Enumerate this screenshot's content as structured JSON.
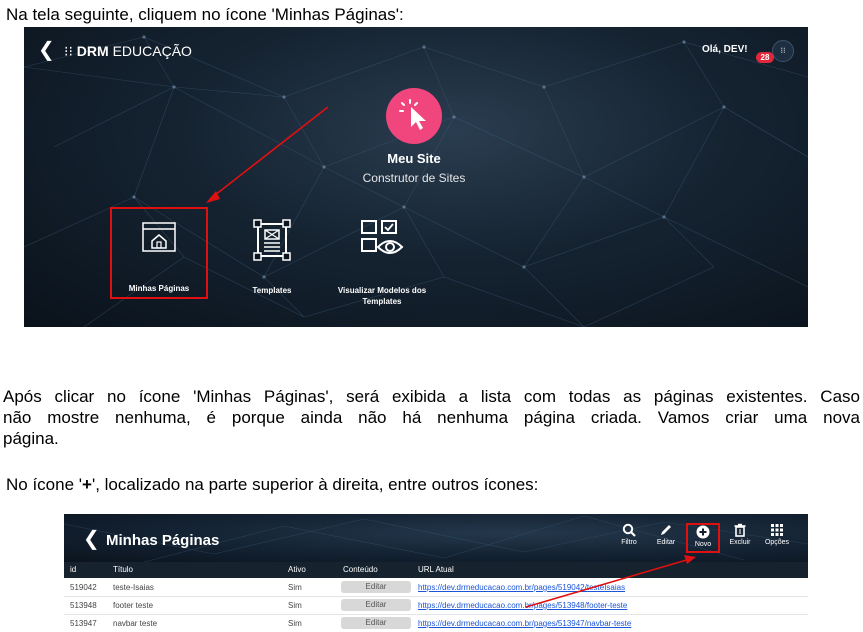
{
  "text": {
    "intro": "Na tela seguinte, cliquem no ícone 'Minhas Páginas':",
    "para2_lines": [
      "Após clicar no ícone 'Minhas Páginas', será exibida a lista com todas as páginas existentes. Caso",
      "não mostre nenhuma, é porque ainda não há nenhuma página criada. Vamos criar uma nova",
      "página."
    ],
    "para3_prefix": "No ícone '",
    "para3_plus": "+",
    "para3_suffix": "', localizado na parte superior à direita, entre outros ícones:"
  },
  "screenshot1": {
    "back": "❮",
    "logo_mark": "⁝⁝",
    "logo_bold": "DRM",
    "logo_light": " EDUCAÇÃO",
    "greeting": "Olá, DEV!",
    "badge": "28",
    "avatar": "⁝⁝",
    "app_title": "Meu Site",
    "app_subtitle": "Construtor de Sites",
    "tiles": [
      {
        "label": "Minhas Páginas"
      },
      {
        "label": "Templates"
      },
      {
        "label_line1": "Visualizar Modelos dos",
        "label_line2": "Templates"
      }
    ]
  },
  "screenshot2": {
    "back": "❮",
    "title": "Minhas Páginas",
    "toolbar": [
      {
        "label": "Filtro",
        "icon": "search-icon"
      },
      {
        "label": "Editar",
        "icon": "pencil-icon"
      },
      {
        "label": "Novo",
        "icon": "plus-circle-icon"
      },
      {
        "label": "Excluir",
        "icon": "trash-icon"
      },
      {
        "label": "Opções",
        "icon": "grid-icon"
      }
    ],
    "columns": [
      "id",
      "Título",
      "Ativo",
      "Conteúdo",
      "URL Atual"
    ],
    "rows": [
      {
        "id": "519042",
        "title": "teste-Isaias",
        "ativo": "Sim",
        "btn": "Editar",
        "url": "https://dev.drmeducacao.com.br/pages/519042/testeIsaias"
      },
      {
        "id": "513948",
        "title": "footer teste",
        "ativo": "Sim",
        "btn": "Editar",
        "url": "https://dev.drmeducacao.com.br/pages/513948/footer-teste"
      },
      {
        "id": "513947",
        "title": "navbar teste",
        "ativo": "Sim",
        "btn": "Editar",
        "url": "https://dev.drmeducacao.com.br/pages/513947/navbar-teste"
      }
    ],
    "colors": {
      "highlight": "#e01010",
      "link": "#1a55d8"
    }
  }
}
